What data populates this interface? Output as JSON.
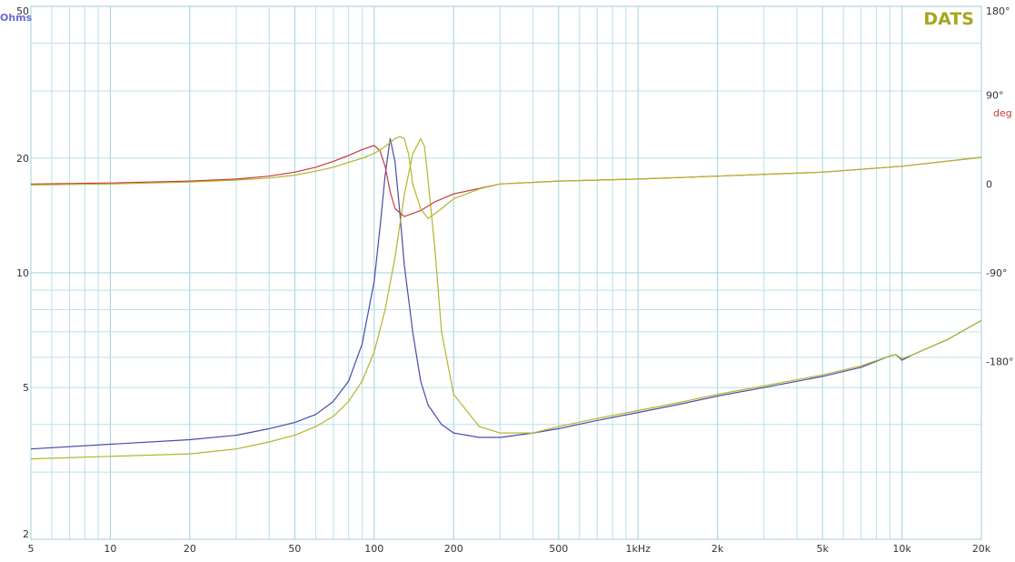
{
  "chart_data": {
    "type": "line",
    "brand": "DATS",
    "y_left_label": "Ohms",
    "y_right_label": "deg",
    "x_scale": "log",
    "y_left_scale": "log",
    "xlim": [
      5,
      20000
    ],
    "ylim_left": [
      2,
      50
    ],
    "ylim_right": [
      -360,
      180
    ],
    "x_ticks": [
      {
        "v": 5,
        "label": "5"
      },
      {
        "v": 10,
        "label": "10"
      },
      {
        "v": 20,
        "label": "20"
      },
      {
        "v": 50,
        "label": "50"
      },
      {
        "v": 100,
        "label": "100"
      },
      {
        "v": 200,
        "label": "200"
      },
      {
        "v": 500,
        "label": "500"
      },
      {
        "v": 1000,
        "label": "1kHz"
      },
      {
        "v": 2000,
        "label": "2k"
      },
      {
        "v": 5000,
        "label": "5k"
      },
      {
        "v": 10000,
        "label": "10k"
      },
      {
        "v": 20000,
        "label": "20k"
      }
    ],
    "y_left_ticks": [
      {
        "v": 50,
        "label": "50"
      },
      {
        "v": 20,
        "label": "20"
      },
      {
        "v": 10,
        "label": "10"
      },
      {
        "v": 5,
        "label": "5"
      },
      {
        "v": 2,
        "label": "2"
      }
    ],
    "y_right_ticks": [
      {
        "v": 180,
        "label": "180°"
      },
      {
        "v": 90,
        "label": "90°"
      },
      {
        "v": 0,
        "label": "0"
      },
      {
        "v": -90,
        "label": "-90°"
      },
      {
        "v": -180,
        "label": "-180°"
      }
    ],
    "grid": true,
    "colors": {
      "grid": "#b8e0ea",
      "grid_major": "#9fd2de",
      "brand": "#a6a61a",
      "y_left_label": "#6a6ad0",
      "y_right_label": "#c83a3a"
    },
    "series": [
      {
        "axis": "left",
        "color": "#4a4aaa",
        "x": [
          5,
          10,
          20,
          30,
          40,
          50,
          60,
          70,
          80,
          90,
          100,
          105,
          110,
          115,
          120,
          125,
          130,
          140,
          150,
          160,
          180,
          200,
          250,
          300,
          400,
          500,
          700,
          1000,
          1500,
          2000,
          3000,
          5000,
          7000,
          9000,
          9500,
          10000,
          11000,
          15000,
          20000
        ],
        "y": [
          3.45,
          3.55,
          3.65,
          3.75,
          3.9,
          4.05,
          4.25,
          4.6,
          5.2,
          6.5,
          9.5,
          13,
          18,
          22.5,
          19.5,
          14.5,
          10.5,
          7.0,
          5.2,
          4.5,
          4.0,
          3.8,
          3.7,
          3.7,
          3.8,
          3.9,
          4.1,
          4.3,
          4.55,
          4.75,
          5.0,
          5.35,
          5.65,
          6.05,
          6.1,
          5.9,
          6.1,
          6.7,
          7.5
        ]
      },
      {
        "axis": "left",
        "color": "#b5b52a",
        "x": [
          5,
          10,
          20,
          30,
          40,
          50,
          60,
          70,
          80,
          90,
          100,
          110,
          120,
          130,
          140,
          150,
          155,
          160,
          170,
          180,
          200,
          250,
          300,
          400,
          500,
          700,
          1000,
          1500,
          2000,
          3000,
          5000,
          7000,
          9000,
          9500,
          10000,
          11000,
          15000,
          20000
        ],
        "y": [
          3.25,
          3.3,
          3.35,
          3.45,
          3.6,
          3.75,
          3.95,
          4.2,
          4.6,
          5.2,
          6.2,
          8.0,
          11,
          16,
          20.5,
          22.5,
          21.5,
          17.5,
          11.5,
          7.0,
          4.8,
          3.95,
          3.8,
          3.8,
          3.95,
          4.15,
          4.35,
          4.6,
          4.8,
          5.05,
          5.4,
          5.7,
          6.05,
          6.1,
          5.95,
          6.1,
          6.7,
          7.5
        ]
      },
      {
        "axis": "right",
        "color": "#c83a3a",
        "x": [
          5,
          10,
          20,
          30,
          40,
          50,
          60,
          70,
          80,
          90,
          100,
          105,
          110,
          115,
          120,
          130,
          150,
          170,
          200,
          300,
          500,
          1000,
          2000,
          5000,
          10000,
          20000
        ],
        "y": [
          0,
          1,
          3,
          5,
          8,
          12,
          17,
          23,
          29,
          35,
          39,
          34,
          18,
          -8,
          -25,
          -33,
          -27,
          -18,
          -10,
          0,
          3,
          5,
          8,
          12,
          18,
          27
        ]
      },
      {
        "axis": "right",
        "color": "#b5b52a",
        "x": [
          5,
          10,
          20,
          30,
          40,
          50,
          60,
          70,
          80,
          90,
          100,
          110,
          120,
          125,
          130,
          135,
          140,
          150,
          160,
          170,
          180,
          200,
          250,
          300,
          500,
          1000,
          2000,
          5000,
          10000,
          20000
        ],
        "y": [
          -1,
          0,
          2,
          4,
          6,
          9,
          13,
          17,
          22,
          26,
          31,
          38,
          46,
          48,
          46,
          30,
          0,
          -25,
          -35,
          -30,
          -25,
          -15,
          -5,
          0,
          3,
          5,
          8,
          12,
          18,
          27
        ]
      }
    ]
  }
}
